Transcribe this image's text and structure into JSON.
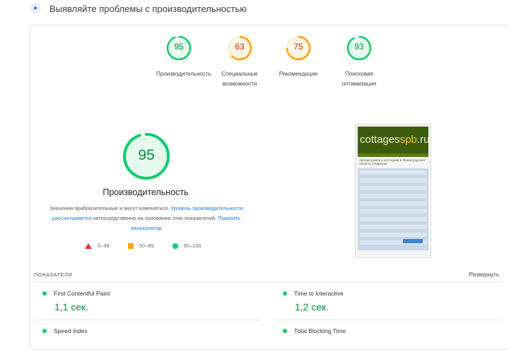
{
  "header": {
    "title": "Выявляйте проблемы с производительностью"
  },
  "categories": [
    {
      "score": "95",
      "label": "Производительность",
      "color": "#0cce6b",
      "text": "#0a8f3f"
    },
    {
      "score": "63",
      "label": "Специальные возможности",
      "color": "#ffa400",
      "text": "#c33300"
    },
    {
      "score": "75",
      "label": "Рекомендации",
      "color": "#ffa400",
      "text": "#c33300"
    },
    {
      "score": "93",
      "label": "Поисковая оптимизация",
      "color": "#0cce6b",
      "text": "#0a8f3f"
    }
  ],
  "main": {
    "score": "95",
    "title": "Производительность",
    "desc1": "Значения приблизительные и могут изменяться.",
    "link1": "Уровень производительности рассчитывается",
    "desc2": "непосредственно на основании этих показателей.",
    "link2": "Показать калькулятор"
  },
  "legend": {
    "fail": "0–49",
    "average": "50–89",
    "pass": "90–100"
  },
  "thumbnail": {
    "logo_a": "cottages",
    "logo_b": "spb",
    "logo_c": ".ru",
    "subtitle": "Аренда домов и коттеджей в Ленинградской области и Карелии"
  },
  "metrics_section": {
    "title": "ПОКАЗАТЕЛИ",
    "expand": "Развернуть"
  },
  "metrics": [
    {
      "name": "First Contentful Paint",
      "value": "1,1 сек."
    },
    {
      "name": "Time to Interactive",
      "value": "1,2 сек."
    },
    {
      "name": "Speed Index",
      "value": ""
    },
    {
      "name": "Total Blocking Time",
      "value": ""
    }
  ]
}
